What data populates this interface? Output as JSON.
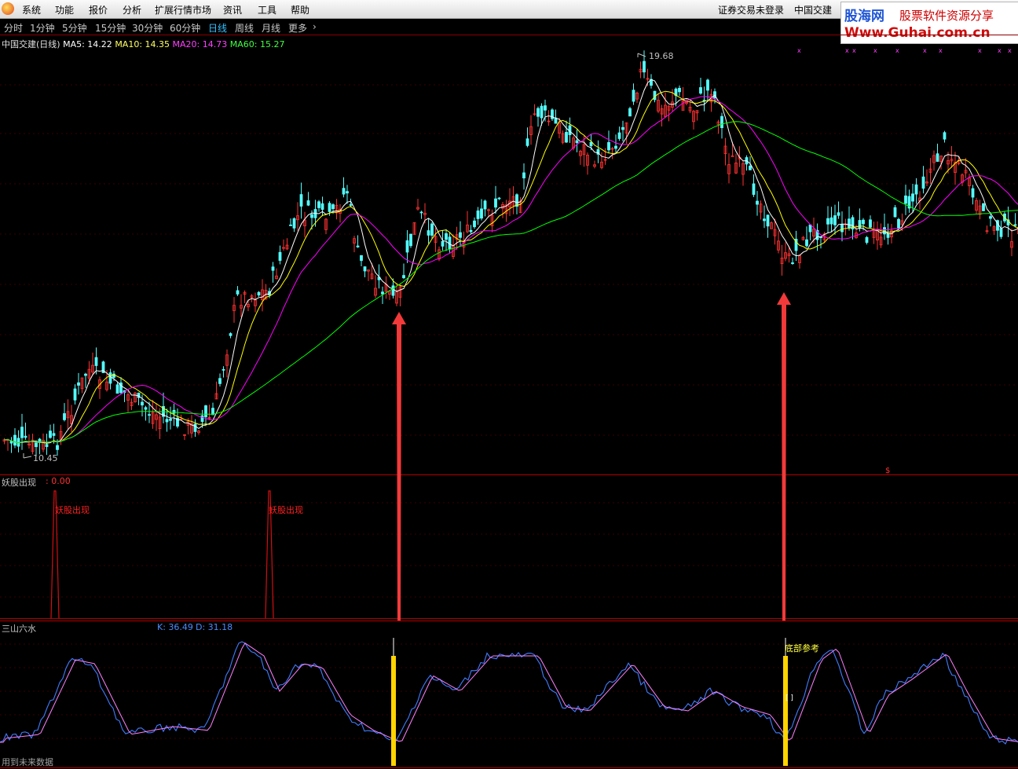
{
  "menu": [
    "系统",
    "功能",
    "报价",
    "分析",
    "扩展行情市场",
    "资讯",
    "工具",
    "帮助"
  ],
  "status": {
    "login": "证券交易未登录",
    "stock": "中国交建"
  },
  "watermark": {
    "brand": "股海网",
    "slogan": "股票软件资源分享",
    "url": "Www.Guhai.com.cn"
  },
  "periods": [
    "分时",
    "1分钟",
    "5分钟",
    "15分钟",
    "30分钟",
    "60分钟",
    "日线",
    "周线",
    "月线",
    "更多"
  ],
  "active_period": "日线",
  "main_chart": {
    "title": "中国交建(日线)",
    "ma5": "MA5: 14.22",
    "ma10": "MA10: 14.35",
    "ma20": "MA20: 14.73",
    "ma60": "MA60: 15.27",
    "high_label": "19.68",
    "low_label": "10.45",
    "colors": {
      "ma5": "#ffffff",
      "ma10": "#ffff00",
      "ma20": "#ff00ff",
      "ma60": "#00ff00",
      "up": "#ff3232",
      "down": "#54ffff"
    }
  },
  "demon_panel": {
    "title": "妖股出现",
    "value": ": 0.00",
    "marker": "妖股出现",
    "color": "#ff2020"
  },
  "kd_panel": {
    "title": "三山六水",
    "k": "K: 36.49",
    "d": "D: 31.18",
    "bottom_label": "底部参考"
  },
  "footer_note": "用到未来数据"
}
